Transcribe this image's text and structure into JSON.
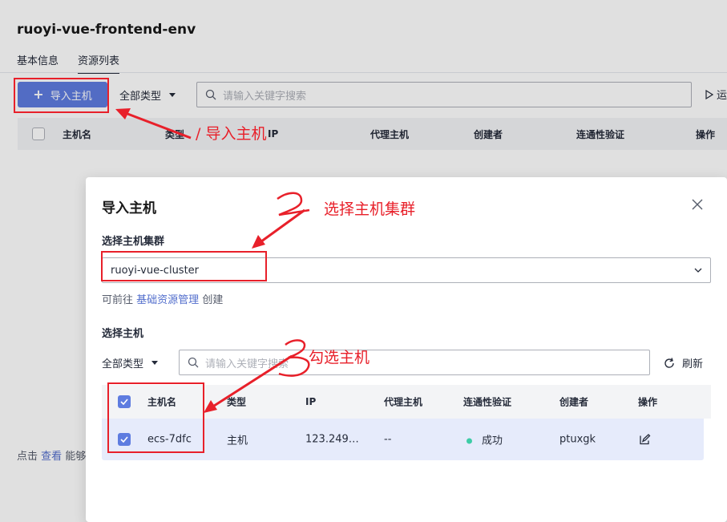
{
  "page": {
    "title": "ruoyi-vue-frontend-env",
    "tabs": [
      {
        "label": "基本信息",
        "active": false
      },
      {
        "label": "资源列表",
        "active": true
      }
    ],
    "toolbar": {
      "import_label": "导入主机",
      "type_filter": "全部类型",
      "search_placeholder": "请输入关键字搜索",
      "run_label": "运"
    },
    "table_headers": [
      "主机名",
      "类型",
      "IP",
      "代理主机",
      "创建者",
      "连通性验证",
      "操作"
    ],
    "footer": {
      "prefix": "点击",
      "link": "查看",
      "suffix": "能够"
    }
  },
  "modal": {
    "title": "导入主机",
    "cluster_label": "选择主机集群",
    "cluster_value": "ruoyi-vue-cluster",
    "hint_prefix": "可前往",
    "hint_link": "基础资源管理",
    "hint_suffix": "创建",
    "host_label": "选择主机",
    "type_filter": "全部类型",
    "search_placeholder": "请输入关键字搜索",
    "refresh_label": "刷新",
    "table_headers": [
      "主机名",
      "类型",
      "IP",
      "代理主机",
      "连通性验证",
      "创建者",
      "操作"
    ],
    "rows": [
      {
        "checked": true,
        "hostname": "ecs-7dfc",
        "type": "主机",
        "ip": "123.249…",
        "proxy": "--",
        "connectivity": "成功",
        "creator": "ptuxgk"
      }
    ]
  },
  "annotations": {
    "step1": "/ 导入主机",
    "step2": "选择主机集群",
    "step3": "勾选主机"
  },
  "colors": {
    "primary": "#5e7ce0",
    "annotation": "#e8202a",
    "success": "#3dcca6",
    "row_selected": "#e6ebfb"
  }
}
